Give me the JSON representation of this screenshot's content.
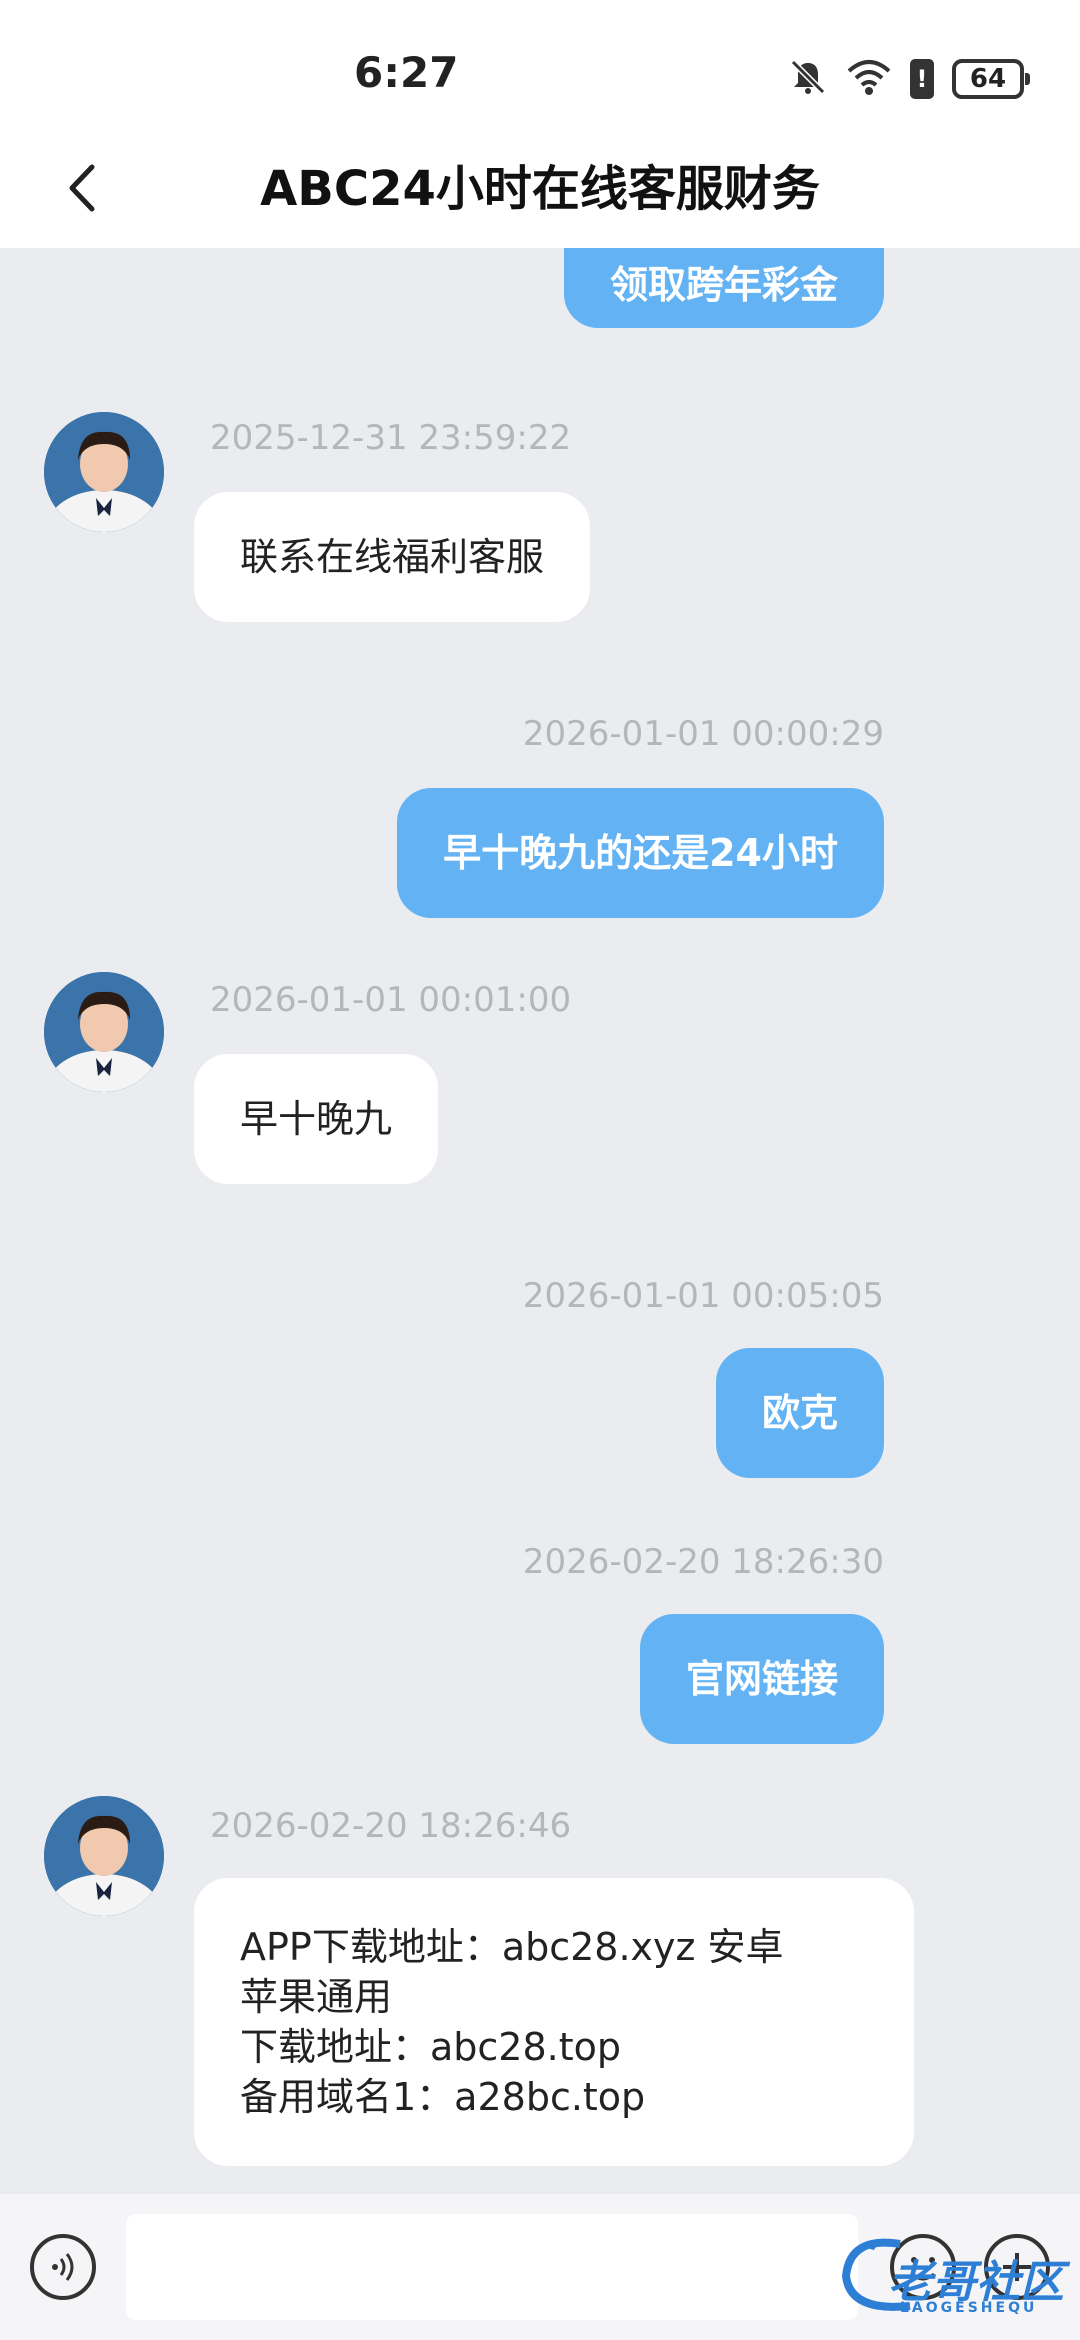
{
  "status": {
    "time": "6:27",
    "battery": "64",
    "battery_alert": "!"
  },
  "header": {
    "title": "ABC24小时在线客服财务"
  },
  "messages": [
    {
      "dir": "out",
      "text": "领取跨年彩金"
    },
    {
      "dir": "in",
      "time": "2025-12-31 23:59:22",
      "text": "联系在线福利客服"
    },
    {
      "dir": "out",
      "time": "2026-01-01 00:00:29",
      "text": "早十晚九的还是24小时"
    },
    {
      "dir": "in",
      "time": "2026-01-01 00:01:00",
      "text": "早十晚九"
    },
    {
      "dir": "out",
      "time": "2026-01-01 00:05:05",
      "text": "欧克"
    },
    {
      "dir": "out",
      "time": "2026-02-20 18:26:30",
      "text": "官网链接"
    },
    {
      "dir": "in",
      "time": "2026-02-20 18:26:46",
      "lines": [
        "APP下载地址：abc28.xyz  安卓",
        "苹果通用",
        "下载地址：abc28.top",
        "备用域名1：a28bc.top"
      ]
    }
  ],
  "input": {
    "placeholder": ""
  },
  "watermark": {
    "main": "老哥社区",
    "sub": "LAOGESHEQU"
  },
  "colors": {
    "outgoing_bubble": "#63b3f4",
    "incoming_bubble": "#ffffff",
    "background": "#ebecef"
  }
}
